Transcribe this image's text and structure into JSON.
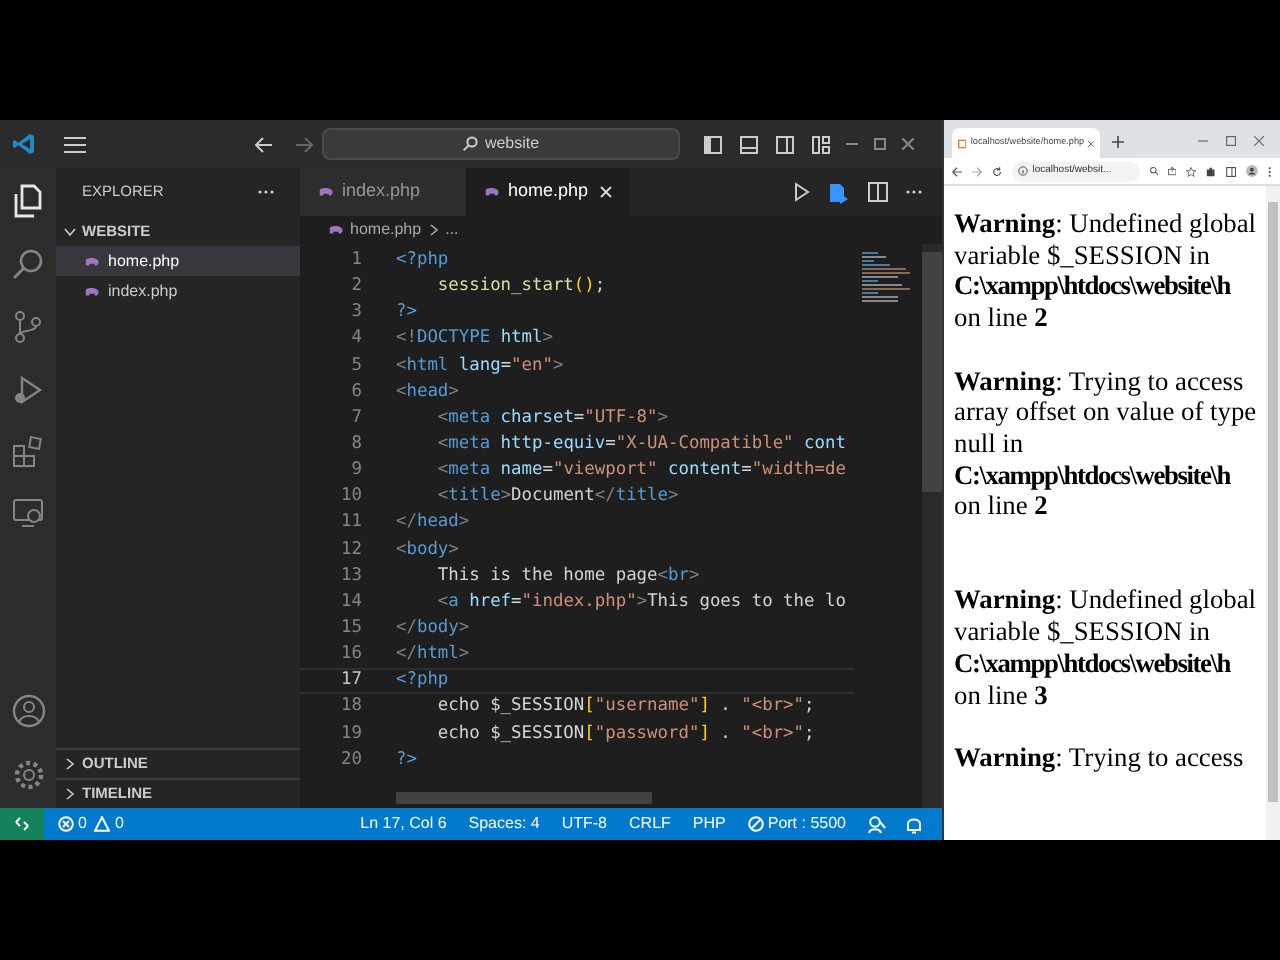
{
  "title_bar": {
    "search": "website"
  },
  "explorer": {
    "title": "EXPLORER",
    "folder": {
      "label": "WEBSITE",
      "expanded": true,
      "children": [
        {
          "label": "home.php",
          "selected": true
        },
        {
          "label": "index.php",
          "selected": false
        }
      ]
    },
    "sections": [
      {
        "label": "OUTLINE",
        "expanded": false
      },
      {
        "label": "TIMELINE",
        "expanded": false
      }
    ]
  },
  "tabs": [
    {
      "label": "index.php",
      "selected": false
    },
    {
      "label": "home.php",
      "selected": true
    }
  ],
  "breadcrumb": [
    "home.php",
    "..."
  ],
  "code": [
    {
      "number": "1",
      "current": false,
      "tokens": [
        {
          "text": "<?php",
          "kind": "php"
        }
      ]
    },
    {
      "number": "2",
      "current": false,
      "tokens": [
        {
          "text": "    session_start",
          "kind": "fn"
        },
        {
          "text": "()",
          "kind": "bracket"
        },
        {
          "text": ";",
          "kind": "plain"
        }
      ]
    },
    {
      "number": "3",
      "current": false,
      "tokens": [
        {
          "text": "?>",
          "kind": "php"
        }
      ]
    },
    {
      "number": "4",
      "current": false,
      "tokens": [
        {
          "text": "<!",
          "kind": "punct"
        },
        {
          "text": "DOCTYPE",
          "kind": "tag"
        },
        {
          "text": " html",
          "kind": "attr"
        },
        {
          "text": ">",
          "kind": "punct"
        }
      ]
    },
    {
      "number": "5",
      "current": false,
      "tokens": [
        {
          "text": "<",
          "kind": "punct"
        },
        {
          "text": "html",
          "kind": "tag"
        },
        {
          "text": " lang",
          "kind": "attr"
        },
        {
          "text": "=",
          "kind": "plain"
        },
        {
          "text": "\"en\"",
          "kind": "string"
        },
        {
          "text": ">",
          "kind": "punct"
        }
      ]
    },
    {
      "number": "6",
      "current": false,
      "tokens": [
        {
          "text": "<",
          "kind": "punct"
        },
        {
          "text": "head",
          "kind": "tag"
        },
        {
          "text": ">",
          "kind": "punct"
        }
      ]
    },
    {
      "number": "7",
      "current": false,
      "tokens": [
        {
          "text": "    <",
          "kind": "punct"
        },
        {
          "text": "meta",
          "kind": "tag"
        },
        {
          "text": " charset",
          "kind": "attr"
        },
        {
          "text": "=",
          "kind": "plain"
        },
        {
          "text": "\"UTF-8\"",
          "kind": "string"
        },
        {
          "text": ">",
          "kind": "punct"
        }
      ]
    },
    {
      "number": "8",
      "current": false,
      "tokens": [
        {
          "text": "    <",
          "kind": "punct"
        },
        {
          "text": "meta",
          "kind": "tag"
        },
        {
          "text": " http-equiv",
          "kind": "attr"
        },
        {
          "text": "=",
          "kind": "plain"
        },
        {
          "text": "\"X-UA-Compatible\"",
          "kind": "string"
        },
        {
          "text": " cont",
          "kind": "attr"
        }
      ]
    },
    {
      "number": "9",
      "current": false,
      "tokens": [
        {
          "text": "    <",
          "kind": "punct"
        },
        {
          "text": "meta",
          "kind": "tag"
        },
        {
          "text": " name",
          "kind": "attr"
        },
        {
          "text": "=",
          "kind": "plain"
        },
        {
          "text": "\"viewport\"",
          "kind": "string"
        },
        {
          "text": " content",
          "kind": "attr"
        },
        {
          "text": "=",
          "kind": "plain"
        },
        {
          "text": "\"width=de",
          "kind": "string"
        }
      ]
    },
    {
      "number": "10",
      "current": false,
      "tokens": [
        {
          "text": "    <",
          "kind": "punct"
        },
        {
          "text": "title",
          "kind": "tag"
        },
        {
          "text": ">",
          "kind": "punct"
        },
        {
          "text": "Document",
          "kind": "plain"
        },
        {
          "text": "</",
          "kind": "punct"
        },
        {
          "text": "title",
          "kind": "tag"
        },
        {
          "text": ">",
          "kind": "punct"
        }
      ]
    },
    {
      "number": "11",
      "current": false,
      "tokens": [
        {
          "text": "</",
          "kind": "punct"
        },
        {
          "text": "head",
          "kind": "tag"
        },
        {
          "text": ">",
          "kind": "punct"
        }
      ]
    },
    {
      "number": "12",
      "current": false,
      "tokens": [
        {
          "text": "<",
          "kind": "punct"
        },
        {
          "text": "body",
          "kind": "tag"
        },
        {
          "text": ">",
          "kind": "punct"
        }
      ]
    },
    {
      "number": "13",
      "current": false,
      "tokens": [
        {
          "text": "    This is the home page",
          "kind": "plain"
        },
        {
          "text": "<",
          "kind": "punct"
        },
        {
          "text": "br",
          "kind": "tag"
        },
        {
          "text": ">",
          "kind": "punct"
        }
      ]
    },
    {
      "number": "14",
      "current": false,
      "tokens": [
        {
          "text": "    <",
          "kind": "punct"
        },
        {
          "text": "a",
          "kind": "tag"
        },
        {
          "text": " href",
          "kind": "attr"
        },
        {
          "text": "=",
          "kind": "plain"
        },
        {
          "text": "\"index.php\"",
          "kind": "string"
        },
        {
          "text": ">",
          "kind": "punct"
        },
        {
          "text": "This goes to the lo",
          "kind": "plain"
        }
      ]
    },
    {
      "number": "15",
      "current": false,
      "tokens": [
        {
          "text": "</",
          "kind": "punct"
        },
        {
          "text": "body",
          "kind": "tag"
        },
        {
          "text": ">",
          "kind": "punct"
        }
      ]
    },
    {
      "number": "16",
      "current": false,
      "tokens": [
        {
          "text": "</",
          "kind": "punct"
        },
        {
          "text": "html",
          "kind": "tag"
        },
        {
          "text": ">",
          "kind": "punct"
        }
      ]
    },
    {
      "number": "17",
      "current": true,
      "tokens": [
        {
          "text": "<?php",
          "kind": "php"
        }
      ]
    },
    {
      "number": "18",
      "current": false,
      "tokens": [
        {
          "text": "    echo $_SESSION",
          "kind": "plain"
        },
        {
          "text": "[",
          "kind": "bracket"
        },
        {
          "text": "\"username\"",
          "kind": "string"
        },
        {
          "text": "]",
          "kind": "bracket"
        },
        {
          "text": " . ",
          "kind": "plain"
        },
        {
          "text": "\"<br>\"",
          "kind": "string"
        },
        {
          "text": ";",
          "kind": "plain"
        }
      ]
    },
    {
      "number": "19",
      "current": false,
      "tokens": [
        {
          "text": "    echo $_SESSION",
          "kind": "plain"
        },
        {
          "text": "[",
          "kind": "bracket"
        },
        {
          "text": "\"password\"",
          "kind": "string"
        },
        {
          "text": "]",
          "kind": "bracket"
        },
        {
          "text": " . ",
          "kind": "plain"
        },
        {
          "text": "\"<br>\"",
          "kind": "string"
        },
        {
          "text": ";",
          "kind": "plain"
        }
      ]
    },
    {
      "number": "20",
      "current": false,
      "tokens": [
        {
          "text": "?>",
          "kind": "php"
        }
      ]
    }
  ],
  "status_bar": {
    "errors": "0",
    "warnings": "0",
    "items": [
      "Ln 17, Col 6",
      "Spaces: 4",
      "UTF-8",
      "CRLF",
      "PHP"
    ],
    "port": "Port : 5500"
  },
  "browser": {
    "tab_title": "localhost/website/home.php",
    "url": "localhost/websit...",
    "content": [
      {
        "kind": "warning",
        "message": "**Warning**: Undefined global variable $_SESSION in",
        "path": "C:\\xampp\\htdocs\\website\\h",
        "line": "on line **2**"
      },
      {
        "kind": "warning",
        "message": "**Warning**: Trying to access array offset on value of type null in",
        "path": "C:\\xampp\\htdocs\\website\\h",
        "line": "on line **2**"
      },
      {
        "kind": "break"
      },
      {
        "kind": "warning",
        "message": "**Warning**: Undefined global variable $_SESSION in",
        "path": "C:\\xampp\\htdocs\\website\\h",
        "line": "on line **3**"
      },
      {
        "kind": "warning",
        "message": "**Warning**: Trying to access"
      }
    ]
  }
}
